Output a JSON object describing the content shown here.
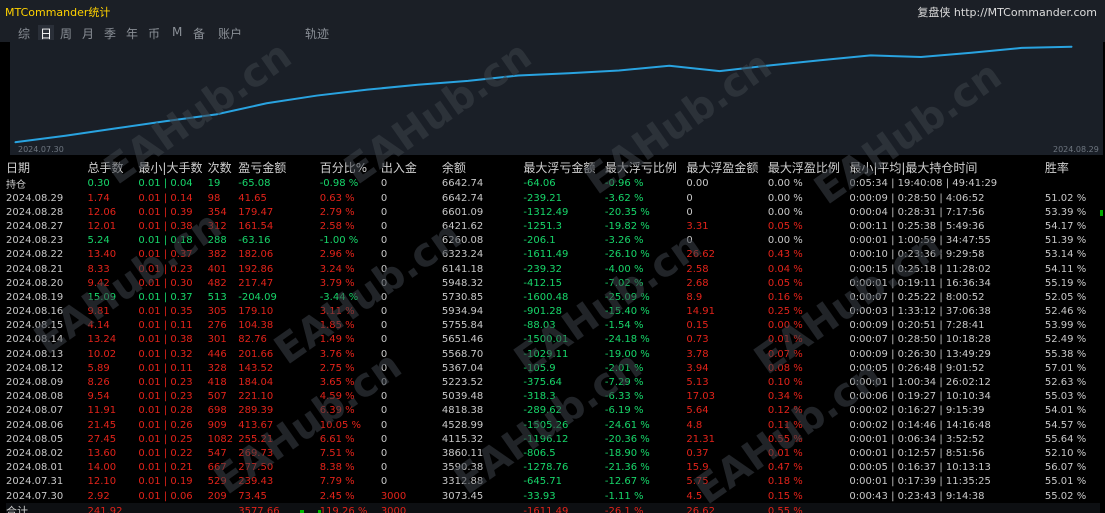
{
  "window": {
    "title": "MTCommander统计",
    "brand": "复盘侠 http://MTCommander.com"
  },
  "tabs": [
    {
      "label": "综",
      "active": false
    },
    {
      "label": "日",
      "active": true
    },
    {
      "label": "周",
      "active": false
    },
    {
      "label": "月",
      "active": false
    },
    {
      "label": "季",
      "active": false
    },
    {
      "label": "年",
      "active": false
    },
    {
      "label": "币",
      "active": false
    },
    {
      "label": "M",
      "active": false
    },
    {
      "label": "备",
      "active": false
    },
    {
      "label": "账户",
      "active": false
    },
    {
      "label": "轨迹",
      "active": false
    }
  ],
  "chart_data": {
    "type": "line",
    "x_start_label": "2024.07.30",
    "x_end_label": "2024.08.29",
    "x": [
      "07.30",
      "07.31",
      "08.01",
      "08.02",
      "08.05",
      "08.06",
      "08.07",
      "08.08",
      "08.09",
      "08.12",
      "08.13",
      "08.14",
      "08.15",
      "08.16",
      "08.19",
      "08.20",
      "08.21",
      "08.22",
      "08.23",
      "08.27",
      "08.28",
      "08.29"
    ],
    "values": [
      3073.45,
      3312.88,
      3590.38,
      3860.11,
      4115.32,
      4528.99,
      4818.38,
      5039.48,
      5223.52,
      5367.04,
      5568.7,
      5651.46,
      5755.84,
      5934.94,
      5730.85,
      5948.32,
      6141.18,
      6323.24,
      6260.08,
      6421.62,
      6601.09,
      6642.74
    ],
    "line_color": "#29a3e0"
  },
  "watermark": "EAHub.cn",
  "table": {
    "headers": [
      "日期",
      "总手数",
      "最小|大手数",
      "次数",
      "盈亏金额",
      "百分比%",
      "出入金",
      "余额",
      "最大浮亏金额",
      "最大浮亏比例",
      "最大浮盈金额",
      "最大浮盈比例",
      "最小|平均|最大持仓时间",
      "胜率"
    ],
    "position_row": {
      "date": "持仓",
      "lots": "0.30",
      "minmax": "0.01 | 0.04",
      "count": "19",
      "pnl": "-65.08",
      "pct": "-0.98 %",
      "io": "0",
      "balance": "6642.74",
      "dd": "-64.06",
      "ddp": "-0.96 %",
      "fp": "0.00",
      "fpp": "0.00 %",
      "time": "0:05:34 | 19:40:08 | 49:41:29",
      "win": "",
      "color": "g"
    },
    "rows": [
      {
        "date": "2024.08.29",
        "lots": "1.74",
        "minmax": "0.01 | 0.14",
        "count": "98",
        "pnl": "41.65",
        "pct": "0.63 %",
        "io": "0",
        "balance": "6642.74",
        "dd": "-239.21",
        "ddp": "-3.62 %",
        "fp": "0",
        "fpp": "0.00 %",
        "time": "0:00:09 | 0:28:50 | 4:06:52",
        "win": "51.02 %",
        "color": "r"
      },
      {
        "date": "2024.08.28",
        "lots": "12.06",
        "minmax": "0.01 | 0.39",
        "count": "354",
        "pnl": "179.47",
        "pct": "2.79 %",
        "io": "0",
        "balance": "6601.09",
        "dd": "-1312.49",
        "ddp": "-20.35 %",
        "fp": "0",
        "fpp": "0.00 %",
        "time": "0:00:04 | 0:28:31 | 7:17:56",
        "win": "53.39 %",
        "color": "r"
      },
      {
        "date": "2024.08.27",
        "lots": "12.01",
        "minmax": "0.01 | 0.38",
        "count": "312",
        "pnl": "161.54",
        "pct": "2.58 %",
        "io": "0",
        "balance": "6421.62",
        "dd": "-1251.3",
        "ddp": "-19.82 %",
        "fp": "3.31",
        "fpp": "0.05 %",
        "time": "0:00:11 | 0:25:38 | 5:49:36",
        "win": "54.17 %",
        "color": "r"
      },
      {
        "date": "2024.08.23",
        "lots": "5.24",
        "minmax": "0.01 | 0.18",
        "count": "288",
        "pnl": "-63.16",
        "pct": "-1.00 %",
        "io": "0",
        "balance": "6260.08",
        "dd": "-206.1",
        "ddp": "-3.26 %",
        "fp": "0",
        "fpp": "0.00 %",
        "time": "0:00:01 | 1:00:59 | 34:47:55",
        "win": "51.39 %",
        "color": "g"
      },
      {
        "date": "2024.08.22",
        "lots": "13.40",
        "minmax": "0.01 | 0.37",
        "count": "382",
        "pnl": "182.06",
        "pct": "2.96 %",
        "io": "0",
        "balance": "6323.24",
        "dd": "-1611.49",
        "ddp": "-26.10 %",
        "fp": "26.62",
        "fpp": "0.43 %",
        "time": "0:00:10 | 0:23:36 | 9:29:58",
        "win": "53.14 %",
        "color": "r"
      },
      {
        "date": "2024.08.21",
        "lots": "8.33",
        "minmax": "0.01 | 0.23",
        "count": "401",
        "pnl": "192.86",
        "pct": "3.24 %",
        "io": "0",
        "balance": "6141.18",
        "dd": "-239.32",
        "ddp": "-4.00 %",
        "fp": "2.58",
        "fpp": "0.04 %",
        "time": "0:00:15 | 0:25:18 | 11:28:02",
        "win": "54.11 %",
        "color": "r"
      },
      {
        "date": "2024.08.20",
        "lots": "9.42",
        "minmax": "0.01 | 0.30",
        "count": "482",
        "pnl": "217.47",
        "pct": "3.79 %",
        "io": "0",
        "balance": "5948.32",
        "dd": "-412.15",
        "ddp": "-7.02 %",
        "fp": "2.68",
        "fpp": "0.05 %",
        "time": "0:00:01 | 0:19:11 | 16:36:34",
        "win": "55.19 %",
        "color": "r"
      },
      {
        "date": "2024.08.19",
        "lots": "15.09",
        "minmax": "0.01 | 0.37",
        "count": "513",
        "pnl": "-204.09",
        "pct": "-3.44 %",
        "io": "0",
        "balance": "5730.85",
        "dd": "-1600.48",
        "ddp": "-25.09 %",
        "fp": "8.9",
        "fpp": "0.16 %",
        "time": "0:00:07 | 0:25:22 | 8:00:52",
        "win": "52.05 %",
        "color": "g"
      },
      {
        "date": "2024.08.16",
        "lots": "9.81",
        "minmax": "0.01 | 0.35",
        "count": "305",
        "pnl": "179.10",
        "pct": "3.11 %",
        "io": "0",
        "balance": "5934.94",
        "dd": "-901.28",
        "ddp": "-15.40 %",
        "fp": "14.91",
        "fpp": "0.25 %",
        "time": "0:00:03 | 1:33:12 | 37:06:38",
        "win": "52.46 %",
        "color": "r"
      },
      {
        "date": "2024.08.15",
        "lots": "4.14",
        "minmax": "0.01 | 0.11",
        "count": "276",
        "pnl": "104.38",
        "pct": "1.85 %",
        "io": "0",
        "balance": "5755.84",
        "dd": "-88.03",
        "ddp": "-1.54 %",
        "fp": "0.15",
        "fpp": "0.00 %",
        "time": "0:00:09 | 0:20:51 | 7:28:41",
        "win": "53.99 %",
        "color": "r"
      },
      {
        "date": "2024.08.14",
        "lots": "13.24",
        "minmax": "0.01 | 0.38",
        "count": "301",
        "pnl": "82.76",
        "pct": "1.49 %",
        "io": "0",
        "balance": "5651.46",
        "dd": "-1500.01",
        "ddp": "-24.18 %",
        "fp": "0.73",
        "fpp": "0.01 %",
        "time": "0:00:07 | 0:28:50 | 10:18:28",
        "win": "52.49 %",
        "color": "r"
      },
      {
        "date": "2024.08.13",
        "lots": "10.02",
        "minmax": "0.01 | 0.32",
        "count": "446",
        "pnl": "201.66",
        "pct": "3.76 %",
        "io": "0",
        "balance": "5568.70",
        "dd": "-1029.11",
        "ddp": "-19.00 %",
        "fp": "3.78",
        "fpp": "0.07 %",
        "time": "0:00:09 | 0:26:30 | 13:49:29",
        "win": "55.38 %",
        "color": "r"
      },
      {
        "date": "2024.08.12",
        "lots": "5.89",
        "minmax": "0.01 | 0.11",
        "count": "328",
        "pnl": "143.52",
        "pct": "2.75 %",
        "io": "0",
        "balance": "5367.04",
        "dd": "-105.9",
        "ddp": "-2.01 %",
        "fp": "3.94",
        "fpp": "0.08 %",
        "time": "0:00:05 | 0:26:48 | 9:01:52",
        "win": "57.01 %",
        "color": "r"
      },
      {
        "date": "2024.08.09",
        "lots": "8.26",
        "minmax": "0.01 | 0.23",
        "count": "418",
        "pnl": "184.04",
        "pct": "3.65 %",
        "io": "0",
        "balance": "5223.52",
        "dd": "-375.64",
        "ddp": "-7.29 %",
        "fp": "5.13",
        "fpp": "0.10 %",
        "time": "0:00:01 | 1:00:34 | 26:02:12",
        "win": "52.63 %",
        "color": "r"
      },
      {
        "date": "2024.08.08",
        "lots": "9.54",
        "minmax": "0.01 | 0.23",
        "count": "507",
        "pnl": "221.10",
        "pct": "4.59 %",
        "io": "0",
        "balance": "5039.48",
        "dd": "-318.3",
        "ddp": "-6.33 %",
        "fp": "17.03",
        "fpp": "0.34 %",
        "time": "0:00:06 | 0:19:27 | 10:10:34",
        "win": "55.03 %",
        "color": "r"
      },
      {
        "date": "2024.08.07",
        "lots": "11.91",
        "minmax": "0.01 | 0.28",
        "count": "698",
        "pnl": "289.39",
        "pct": "6.39 %",
        "io": "0",
        "balance": "4818.38",
        "dd": "-289.62",
        "ddp": "-6.19 %",
        "fp": "5.64",
        "fpp": "0.12 %",
        "time": "0:00:02 | 0:16:27 | 9:15:39",
        "win": "54.01 %",
        "color": "r"
      },
      {
        "date": "2024.08.06",
        "lots": "21.45",
        "minmax": "0.01 | 0.26",
        "count": "909",
        "pnl": "413.67",
        "pct": "10.05 %",
        "io": "0",
        "balance": "4528.99",
        "dd": "-1505.26",
        "ddp": "-24.61 %",
        "fp": "4.8",
        "fpp": "0.11 %",
        "time": "0:00:02 | 0:14:46 | 14:16:48",
        "win": "54.57 %",
        "color": "r"
      },
      {
        "date": "2024.08.05",
        "lots": "27.45",
        "minmax": "0.01 | 0.25",
        "count": "1082",
        "pnl": "255.21",
        "pct": "6.61 %",
        "io": "0",
        "balance": "4115.32",
        "dd": "-1196.12",
        "ddp": "-20.36 %",
        "fp": "21.31",
        "fpp": "0.55 %",
        "time": "0:00:01 | 0:06:34 | 3:52:52",
        "win": "55.64 %",
        "color": "r"
      },
      {
        "date": "2024.08.02",
        "lots": "13.60",
        "minmax": "0.01 | 0.22",
        "count": "547",
        "pnl": "269.73",
        "pct": "7.51 %",
        "io": "0",
        "balance": "3860.11",
        "dd": "-806.5",
        "ddp": "-18.90 %",
        "fp": "0.37",
        "fpp": "0.01 %",
        "time": "0:00:01 | 0:12:57 | 8:51:56",
        "win": "52.10 %",
        "color": "r"
      },
      {
        "date": "2024.08.01",
        "lots": "14.00",
        "minmax": "0.01 | 0.21",
        "count": "667",
        "pnl": "277.50",
        "pct": "8.38 %",
        "io": "0",
        "balance": "3590.38",
        "dd": "-1278.76",
        "ddp": "-21.36 %",
        "fp": "15.9",
        "fpp": "0.47 %",
        "time": "0:00:05 | 0:16:37 | 10:13:13",
        "win": "56.07 %",
        "color": "r"
      },
      {
        "date": "2024.07.31",
        "lots": "12.10",
        "minmax": "0.01 | 0.19",
        "count": "529",
        "pnl": "239.43",
        "pct": "7.79 %",
        "io": "0",
        "balance": "3312.88",
        "dd": "-645.71",
        "ddp": "-12.67 %",
        "fp": "5.75",
        "fpp": "0.18 %",
        "time": "0:00:01 | 0:17:39 | 11:35:25",
        "win": "55.01 %",
        "color": "r"
      },
      {
        "date": "2024.07.30",
        "lots": "2.92",
        "minmax": "0.01 | 0.06",
        "count": "209",
        "pnl": "73.45",
        "pct": "2.45 %",
        "io": "3000",
        "balance": "3073.45",
        "dd": "-33.93",
        "ddp": "-1.11 %",
        "fp": "4.5",
        "fpp": "0.15 %",
        "time": "0:00:43 | 0:23:43 | 9:14:38",
        "win": "55.02 %",
        "color": "r"
      }
    ],
    "total_row": {
      "date": "合计",
      "lots": "241.92",
      "minmax": "",
      "count": "",
      "pnl": "3577.66",
      "pct": "119.26 %",
      "io": "3000",
      "balance": "",
      "dd": "-1611.49",
      "ddp": "-26.1 %",
      "fp": "26.62",
      "fpp": "0.55 %",
      "time": "",
      "win": ""
    }
  }
}
